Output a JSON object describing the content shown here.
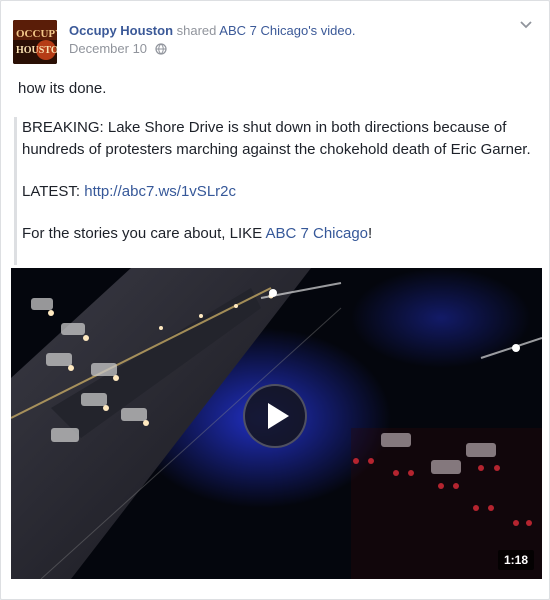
{
  "post": {
    "author": "Occupy Houston",
    "action_text": "shared",
    "shared_from": "ABC 7 Chicago",
    "shared_suffix": "'s video.",
    "date": "December 10",
    "privacy_icon": "globe-icon",
    "menu_icon": "chevron-down-icon",
    "avatar_text": "OCCUPY HOUSTON",
    "message": "how its done."
  },
  "shared_post": {
    "breaking_text": "BREAKING: Lake Shore Drive is shut down in both directions because of hundreds of protesters marching against the chokehold death of Eric Garner.",
    "latest_label": "LATEST: ",
    "latest_link": "http://abc7.ws/1vSLr2c",
    "cta_prefix": "For the stories you care about, LIKE ",
    "cta_link": "ABC 7 Chicago",
    "cta_suffix": "!"
  },
  "video": {
    "duration": "1:18",
    "play_icon": "play-icon"
  },
  "colors": {
    "link": "#3b5998",
    "meta": "#90949c",
    "text": "#1d2129"
  }
}
